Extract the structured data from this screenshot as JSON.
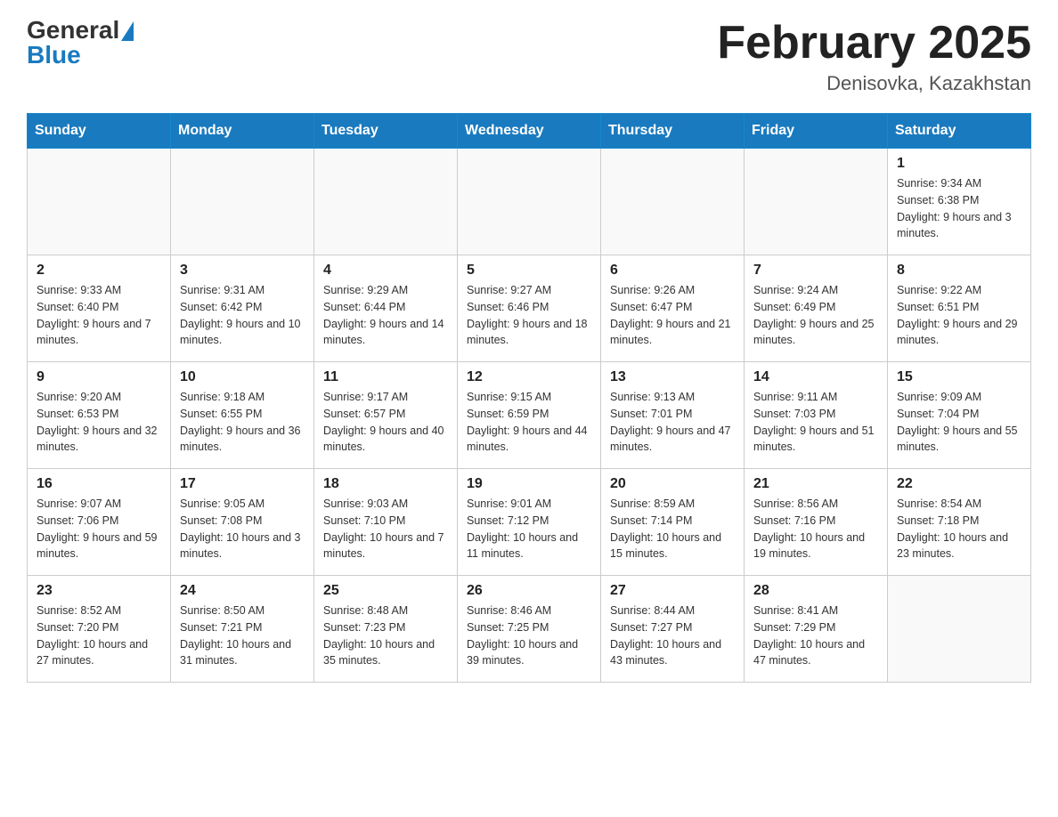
{
  "header": {
    "logo_general": "General",
    "logo_blue": "Blue",
    "month_title": "February 2025",
    "location": "Denisovka, Kazakhstan"
  },
  "days_of_week": [
    "Sunday",
    "Monday",
    "Tuesday",
    "Wednesday",
    "Thursday",
    "Friday",
    "Saturday"
  ],
  "weeks": [
    [
      {
        "day": "",
        "info": ""
      },
      {
        "day": "",
        "info": ""
      },
      {
        "day": "",
        "info": ""
      },
      {
        "day": "",
        "info": ""
      },
      {
        "day": "",
        "info": ""
      },
      {
        "day": "",
        "info": ""
      },
      {
        "day": "1",
        "info": "Sunrise: 9:34 AM\nSunset: 6:38 PM\nDaylight: 9 hours and 3 minutes."
      }
    ],
    [
      {
        "day": "2",
        "info": "Sunrise: 9:33 AM\nSunset: 6:40 PM\nDaylight: 9 hours and 7 minutes."
      },
      {
        "day": "3",
        "info": "Sunrise: 9:31 AM\nSunset: 6:42 PM\nDaylight: 9 hours and 10 minutes."
      },
      {
        "day": "4",
        "info": "Sunrise: 9:29 AM\nSunset: 6:44 PM\nDaylight: 9 hours and 14 minutes."
      },
      {
        "day": "5",
        "info": "Sunrise: 9:27 AM\nSunset: 6:46 PM\nDaylight: 9 hours and 18 minutes."
      },
      {
        "day": "6",
        "info": "Sunrise: 9:26 AM\nSunset: 6:47 PM\nDaylight: 9 hours and 21 minutes."
      },
      {
        "day": "7",
        "info": "Sunrise: 9:24 AM\nSunset: 6:49 PM\nDaylight: 9 hours and 25 minutes."
      },
      {
        "day": "8",
        "info": "Sunrise: 9:22 AM\nSunset: 6:51 PM\nDaylight: 9 hours and 29 minutes."
      }
    ],
    [
      {
        "day": "9",
        "info": "Sunrise: 9:20 AM\nSunset: 6:53 PM\nDaylight: 9 hours and 32 minutes."
      },
      {
        "day": "10",
        "info": "Sunrise: 9:18 AM\nSunset: 6:55 PM\nDaylight: 9 hours and 36 minutes."
      },
      {
        "day": "11",
        "info": "Sunrise: 9:17 AM\nSunset: 6:57 PM\nDaylight: 9 hours and 40 minutes."
      },
      {
        "day": "12",
        "info": "Sunrise: 9:15 AM\nSunset: 6:59 PM\nDaylight: 9 hours and 44 minutes."
      },
      {
        "day": "13",
        "info": "Sunrise: 9:13 AM\nSunset: 7:01 PM\nDaylight: 9 hours and 47 minutes."
      },
      {
        "day": "14",
        "info": "Sunrise: 9:11 AM\nSunset: 7:03 PM\nDaylight: 9 hours and 51 minutes."
      },
      {
        "day": "15",
        "info": "Sunrise: 9:09 AM\nSunset: 7:04 PM\nDaylight: 9 hours and 55 minutes."
      }
    ],
    [
      {
        "day": "16",
        "info": "Sunrise: 9:07 AM\nSunset: 7:06 PM\nDaylight: 9 hours and 59 minutes."
      },
      {
        "day": "17",
        "info": "Sunrise: 9:05 AM\nSunset: 7:08 PM\nDaylight: 10 hours and 3 minutes."
      },
      {
        "day": "18",
        "info": "Sunrise: 9:03 AM\nSunset: 7:10 PM\nDaylight: 10 hours and 7 minutes."
      },
      {
        "day": "19",
        "info": "Sunrise: 9:01 AM\nSunset: 7:12 PM\nDaylight: 10 hours and 11 minutes."
      },
      {
        "day": "20",
        "info": "Sunrise: 8:59 AM\nSunset: 7:14 PM\nDaylight: 10 hours and 15 minutes."
      },
      {
        "day": "21",
        "info": "Sunrise: 8:56 AM\nSunset: 7:16 PM\nDaylight: 10 hours and 19 minutes."
      },
      {
        "day": "22",
        "info": "Sunrise: 8:54 AM\nSunset: 7:18 PM\nDaylight: 10 hours and 23 minutes."
      }
    ],
    [
      {
        "day": "23",
        "info": "Sunrise: 8:52 AM\nSunset: 7:20 PM\nDaylight: 10 hours and 27 minutes."
      },
      {
        "day": "24",
        "info": "Sunrise: 8:50 AM\nSunset: 7:21 PM\nDaylight: 10 hours and 31 minutes."
      },
      {
        "day": "25",
        "info": "Sunrise: 8:48 AM\nSunset: 7:23 PM\nDaylight: 10 hours and 35 minutes."
      },
      {
        "day": "26",
        "info": "Sunrise: 8:46 AM\nSunset: 7:25 PM\nDaylight: 10 hours and 39 minutes."
      },
      {
        "day": "27",
        "info": "Sunrise: 8:44 AM\nSunset: 7:27 PM\nDaylight: 10 hours and 43 minutes."
      },
      {
        "day": "28",
        "info": "Sunrise: 8:41 AM\nSunset: 7:29 PM\nDaylight: 10 hours and 47 minutes."
      },
      {
        "day": "",
        "info": ""
      }
    ]
  ]
}
